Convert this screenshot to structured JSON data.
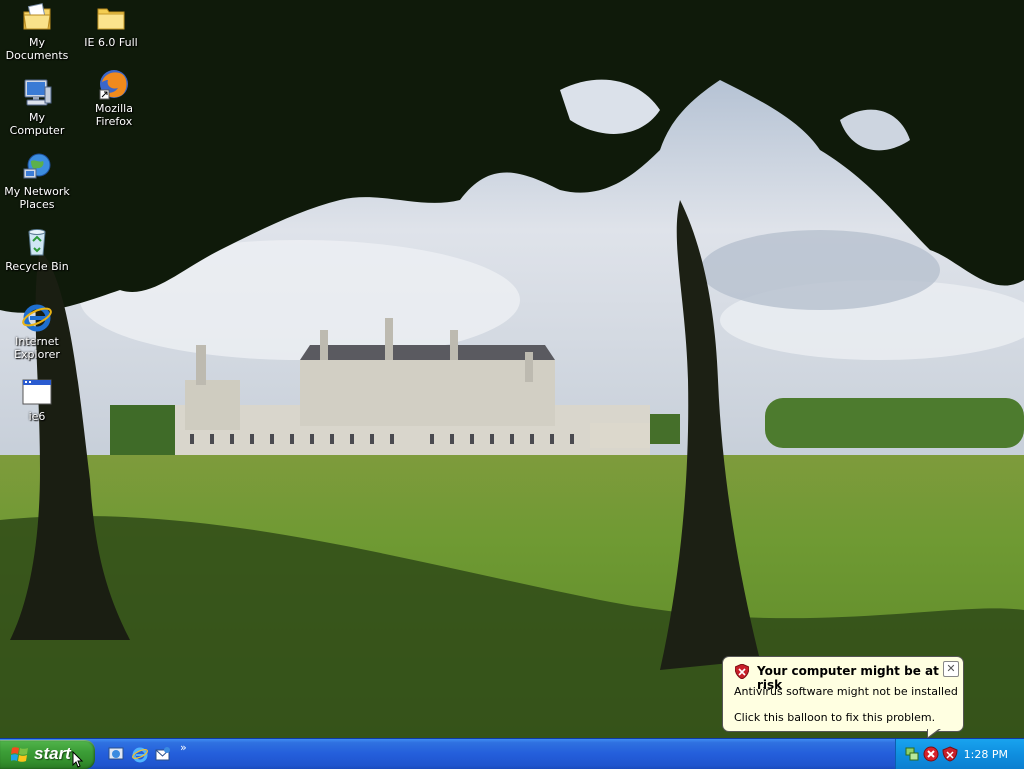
{
  "desktop": {
    "icons": [
      {
        "label": "My Documents",
        "icon": "my-documents-icon"
      },
      {
        "label": "IE 6.0 Full",
        "icon": "folder-icon"
      },
      {
        "label": "My Computer",
        "icon": "my-computer-icon"
      },
      {
        "label": "Mozilla Firefox",
        "icon": "firefox-icon"
      },
      {
        "label": "My Network Places",
        "icon": "network-places-icon"
      },
      {
        "label": "Recycle Bin",
        "icon": "recycle-bin-icon"
      },
      {
        "label": "Internet Explorer",
        "icon": "internet-explorer-icon"
      },
      {
        "label": "ie6",
        "icon": "application-window-icon"
      }
    ]
  },
  "taskbar": {
    "start_label": "start",
    "quick_launch": [
      "show-desktop-icon",
      "internet-explorer-icon",
      "outlook-express-icon"
    ],
    "chevron": "»",
    "clock": "1:28 PM",
    "tray_icons": [
      "network-icon",
      "security-alert-icon",
      "security-center-shield-icon"
    ]
  },
  "balloon": {
    "title": "Your computer might be at risk",
    "line1": "Antivirus software might not be installed",
    "line2": "Click this balloon to fix this problem.",
    "close": "✕"
  },
  "colors": {
    "taskbar_blue": "#245edb",
    "start_green": "#3c9e37",
    "tray_blue": "#0f8fe0",
    "balloon_bg": "#ffffe1"
  }
}
